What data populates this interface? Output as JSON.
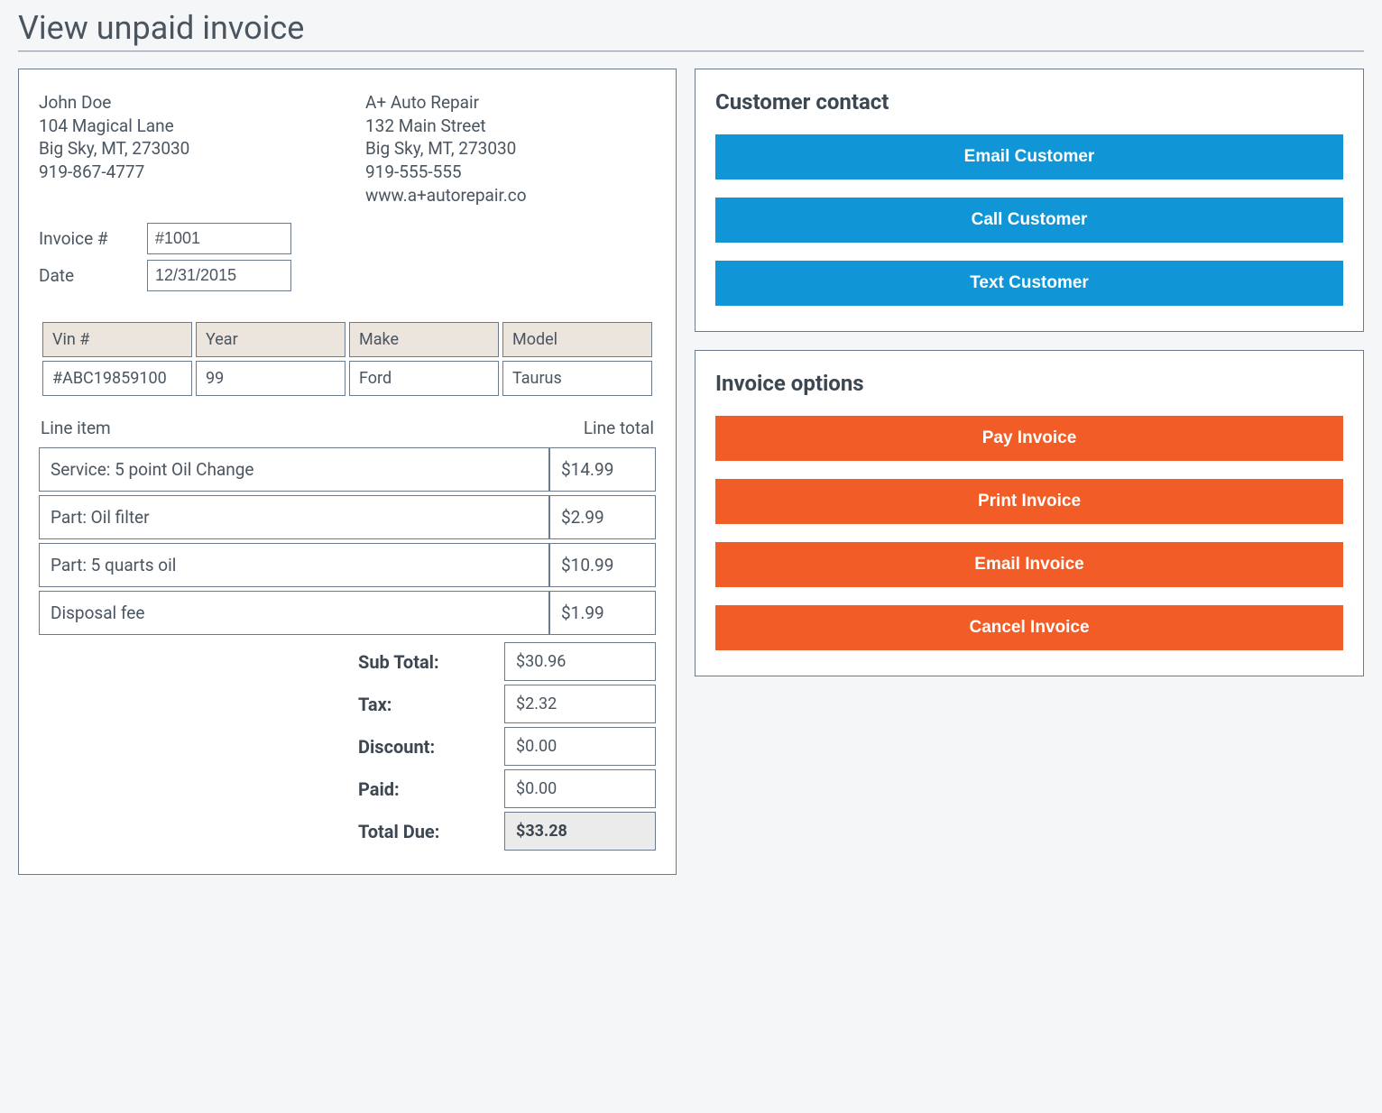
{
  "page": {
    "title": "View unpaid invoice"
  },
  "customer": {
    "name": "John Doe",
    "address_line": "104 Magical Lane",
    "city_state_zip": "Big Sky, MT, 273030",
    "phone": "919-867-4777"
  },
  "company": {
    "name": "A+ Auto Repair",
    "address_line": "132 Main Street",
    "city_state_zip": "Big Sky, MT, 273030",
    "phone": "919-555-555",
    "website": "www.a+autorepair.co"
  },
  "invoice_meta": {
    "number_label": "Invoice #",
    "number_value": "#1001",
    "date_label": "Date",
    "date_value": "12/31/2015"
  },
  "vehicle": {
    "headers": {
      "vin": "Vin #",
      "year": "Year",
      "make": "Make",
      "model": "Model"
    },
    "row": {
      "vin": "#ABC19859100",
      "year": "99",
      "make": "Ford",
      "model": "Taurus"
    }
  },
  "lines": {
    "header_item": "Line item",
    "header_total": "Line total",
    "rows": [
      {
        "item": "Service: 5 point Oil Change",
        "total": "$14.99"
      },
      {
        "item": "Part: Oil filter",
        "total": "$2.99"
      },
      {
        "item": "Part: 5 quarts oil",
        "total": "$10.99"
      },
      {
        "item": "Disposal fee",
        "total": "$1.99"
      }
    ]
  },
  "totals": {
    "subtotal_label": "Sub Total:",
    "subtotal_value": "$30.96",
    "tax_label": "Tax:",
    "tax_value": "$2.32",
    "discount_label": "Discount:",
    "discount_value": "$0.00",
    "paid_label": "Paid:",
    "paid_value": "$0.00",
    "due_label": "Total Due:",
    "due_value": "$33.28"
  },
  "contact_panel": {
    "title": "Customer contact",
    "email_btn": "Email Customer",
    "call_btn": "Call Customer",
    "text_btn": "Text Customer"
  },
  "options_panel": {
    "title": "Invoice options",
    "pay_btn": "Pay Invoice",
    "print_btn": "Print Invoice",
    "email_btn": "Email Invoice",
    "cancel_btn": "Cancel Invoice"
  }
}
